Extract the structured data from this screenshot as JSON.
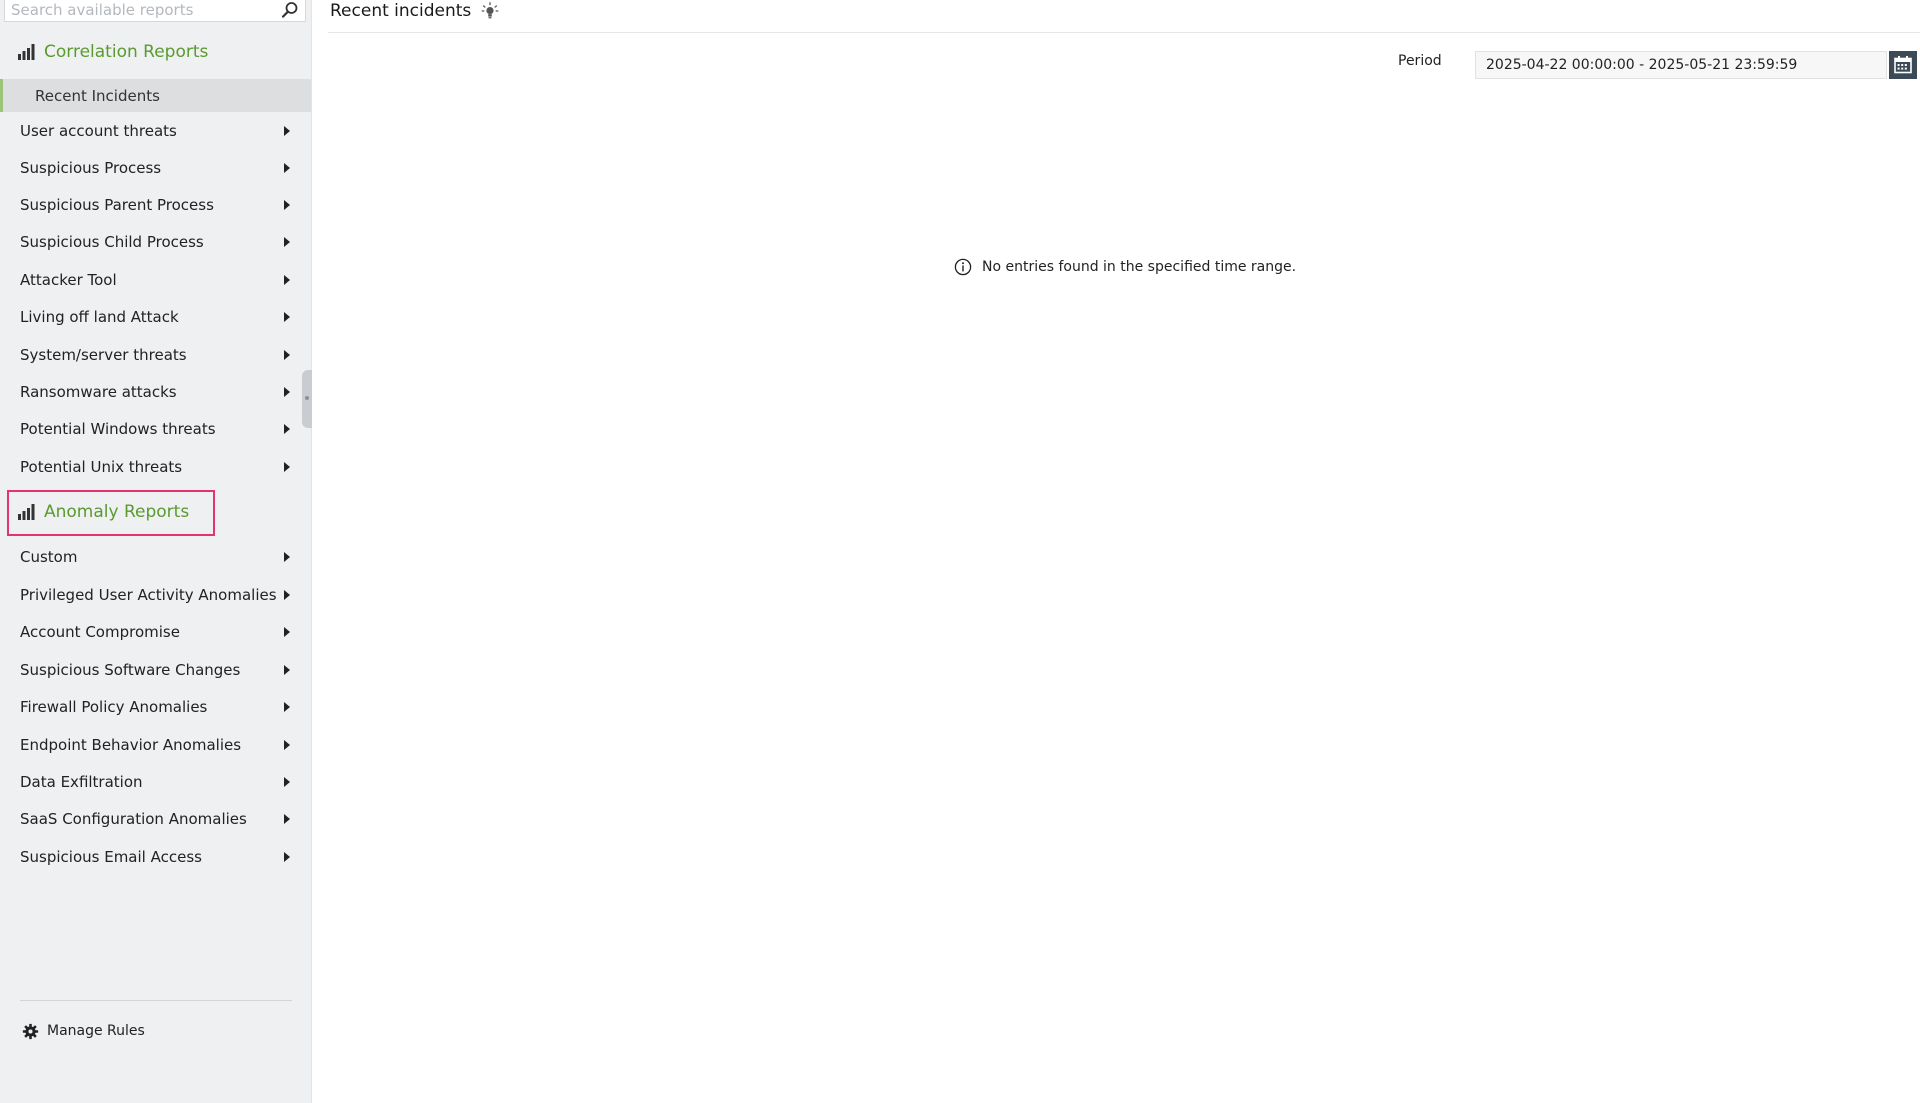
{
  "sidebar": {
    "search": {
      "placeholder": "Search available reports",
      "value": ""
    },
    "correlation": {
      "title": "Correlation Reports",
      "active_item": "Recent Incidents",
      "items": [
        {
          "label": "User account threats"
        },
        {
          "label": "Suspicious Process"
        },
        {
          "label": "Suspicious Parent Process"
        },
        {
          "label": "Suspicious Child Process"
        },
        {
          "label": "Attacker Tool"
        },
        {
          "label": "Living off land Attack"
        },
        {
          "label": "System/server threats"
        },
        {
          "label": "Ransomware attacks"
        },
        {
          "label": "Potential Windows threats"
        },
        {
          "label": "Potential Unix threats"
        }
      ]
    },
    "anomaly": {
      "title": "Anomaly Reports",
      "items": [
        {
          "label": "Custom"
        },
        {
          "label": "Privileged User Activity Anomalies"
        },
        {
          "label": "Account Compromise"
        },
        {
          "label": "Suspicious Software Changes"
        },
        {
          "label": "Firewall Policy Anomalies"
        },
        {
          "label": "Endpoint Behavior Anomalies"
        },
        {
          "label": "Data Exfiltration"
        },
        {
          "label": "SaaS Configuration Anomalies"
        },
        {
          "label": "Suspicious Email Access"
        }
      ]
    },
    "footer": {
      "manage_rules": "Manage Rules"
    }
  },
  "main": {
    "title": "Recent incidents",
    "period": {
      "label": "Period",
      "value": "2025-04-22 00:00:00 - 2025-05-21 23:59:59"
    },
    "empty_message": "No entries found in the specified time range."
  },
  "colors": {
    "section_header": "#5a9a2f",
    "highlight": "#e5336f",
    "active_accent": "#9cc57a",
    "calendar_button": "#3b4a56"
  },
  "icons": {
    "search": "search-icon",
    "section": "bar-chart-icon",
    "expand": "caret-right-icon",
    "gear": "gear-icon",
    "tip": "lightbulb-icon",
    "calendar": "calendar-icon",
    "info": "info-icon"
  }
}
